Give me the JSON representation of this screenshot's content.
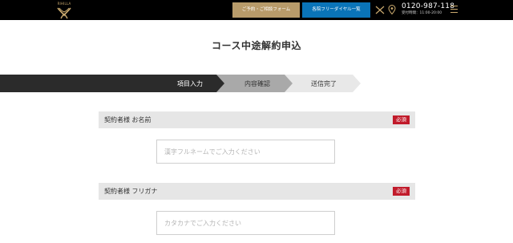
{
  "header": {
    "logo_text": "RIHILLA",
    "contact_button": "ご予約・ご相談フォーム",
    "free_dial_button": "各院フリーダイヤル一覧",
    "phone": "0120-987-118",
    "hours": "受付時間：11:00-20:00"
  },
  "page": {
    "title": "コース中途解約申込"
  },
  "steps": [
    {
      "label": "項目入力",
      "state": "active"
    },
    {
      "label": "内容確認",
      "state": "next"
    },
    {
      "label": "送信完了",
      "state": "last"
    }
  ],
  "form": {
    "fields": [
      {
        "label": "契約者様 お名前",
        "required_badge": "必須",
        "placeholder": "漢字フルネームでご入力ください",
        "value": ""
      },
      {
        "label": "契約者様 フリガナ",
        "required_badge": "必須",
        "placeholder": "カタカナでご入力ください",
        "value": ""
      }
    ]
  },
  "colors": {
    "header_bg": "#000000",
    "gold": "#b89b6a",
    "blue": "#0a74b8",
    "required_red": "#c11b2b",
    "step_active": "#2b2b2b",
    "step_next": "#a9a9a9",
    "step_last": "#e8e8e8"
  },
  "icons": {
    "logo": "gold-ornament-logo",
    "x": "x-logo-icon",
    "pin": "map-pin-icon",
    "menu": "hamburger-menu-icon"
  }
}
